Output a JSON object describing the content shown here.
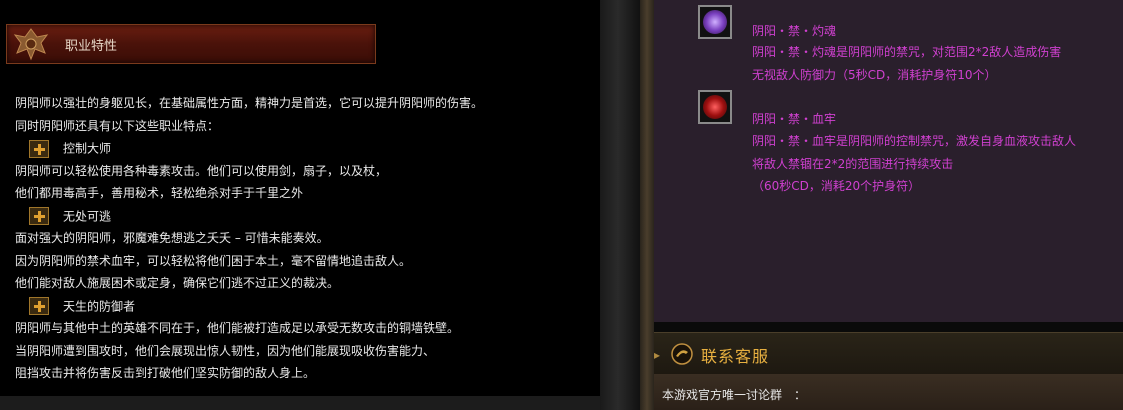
{
  "left": {
    "header_title": "职业特性",
    "lines": [
      {
        "type": "text",
        "text": "阴阳师以强壮的身躯见长，在基础属性方面，精神力是首选，它可以提升阴阳师的伤害。"
      },
      {
        "type": "text",
        "text": "同时阴阳师还具有以下这些职业特点："
      },
      {
        "type": "trait",
        "text": "控制大师"
      },
      {
        "type": "text",
        "text": "阴阳师可以轻松使用各种毒素攻击。他们可以使用剑，扇子，以及杖，"
      },
      {
        "type": "text",
        "text": "他们都用毒高手，善用秘术，轻松绝杀对手于千里之外"
      },
      {
        "type": "trait",
        "text": "无处可逃"
      },
      {
        "type": "text",
        "text": "面对强大的阴阳师，邪魔难免想逃之夭夭 – 可惜未能奏效。"
      },
      {
        "type": "text",
        "text": "因为阴阳师的禁术血牢，可以轻松将他们困于本土，毫不留情地追击敌人。"
      },
      {
        "type": "text",
        "text": "他们能对敌人施展困术或定身，确保它们逃不过正义的裁决。"
      },
      {
        "type": "trait",
        "text": "天生的防御者"
      },
      {
        "type": "text",
        "text": "阴阳师与其他中土的英雄不同在于，他们能被打造成足以承受无数攻击的铜墙铁壁。"
      },
      {
        "type": "text",
        "text": "当阴阳师遭到围攻时，他们会展现出惊人韧性，因为他们能展现吸收伤害能力、"
      },
      {
        "type": "text",
        "text": "阻挡攻击并将伤害反击到打破他们坚实防御的敌人身上。"
      }
    ]
  },
  "skills": [
    {
      "title": "阴阳・禁・灼魂",
      "icon": "burning-soul-icon",
      "desc": [
        "阴阳・禁・灼魂是阴阳师的禁咒，对范围2*2敌人造成伤害",
        "无视敌人防御力（5秒CD，消耗护身符10个）"
      ]
    },
    {
      "title": "阴阳・禁・血牢",
      "icon": "blood-prison-icon",
      "desc": [
        "阴阳・禁・血牢是阴阳师的控制禁咒，激发自身血液攻击敌人",
        "将敌人禁锢在2*2的范围进行持续攻击",
        "（60秒CD，消耗20个护身符）"
      ]
    }
  ],
  "contact": {
    "title": "联系客服",
    "group_text": "本游戏官方唯一讨论群　："
  },
  "colors": {
    "skill_text": "#d040d0",
    "contact_title": "#e8b040",
    "header_bg": "#4a120a"
  }
}
